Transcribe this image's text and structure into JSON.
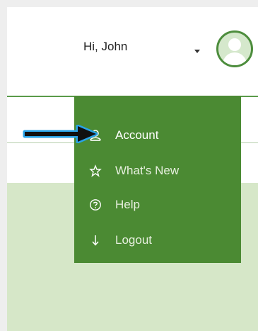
{
  "header": {
    "greeting": "Hi, John"
  },
  "menu": {
    "items": [
      {
        "label": "Account",
        "icon": "user-icon"
      },
      {
        "label": "What's New",
        "icon": "star-icon"
      },
      {
        "label": "Help",
        "icon": "help-icon"
      },
      {
        "label": "Logout",
        "icon": "logout-icon"
      }
    ]
  },
  "colors": {
    "menu_bg": "#4b8a33",
    "content_bg": "#d6e7c8",
    "accent": "#4d8d3d",
    "arrow_outline": "#29a3e8"
  }
}
